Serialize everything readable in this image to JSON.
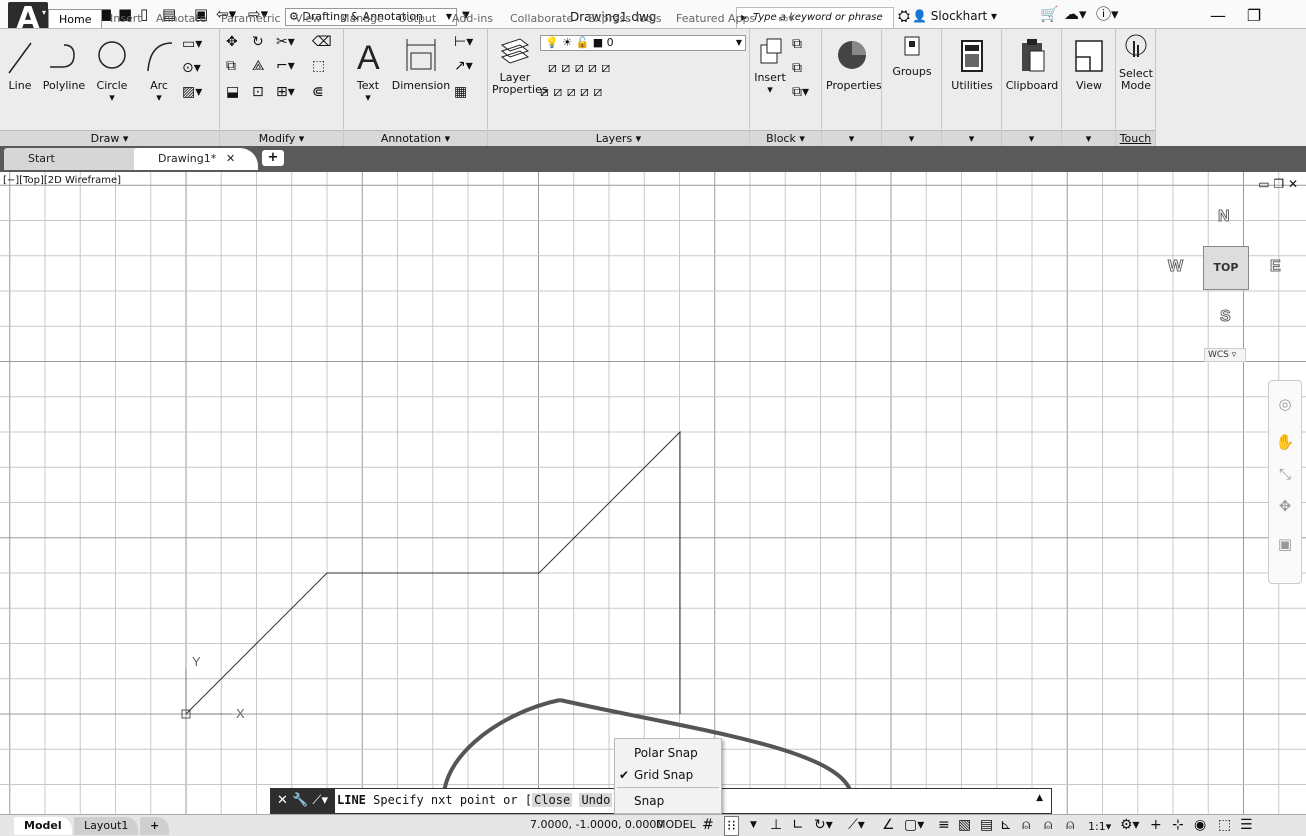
{
  "titlebar": {
    "workspace": "Drafting & Annotation",
    "document_title": "Drawing1.dwg",
    "search_placeholder": "Type a keyword or phrase",
    "user_name": "Slockhart"
  },
  "ribbon_tabs": [
    "Home",
    "Insert",
    "Annotate",
    "Parametric",
    "View",
    "Manage",
    "Output",
    "Add-ins",
    "Collaborate",
    "Express Tools",
    "Featured Apps"
  ],
  "ribbon": {
    "draw": {
      "title": "Draw",
      "line": "Line",
      "polyline": "Polyline",
      "circle": "Circle",
      "arc": "Arc"
    },
    "modify": {
      "title": "Modify"
    },
    "annotation": {
      "title": "Annotation",
      "text": "Text",
      "dimension": "Dimension"
    },
    "layers": {
      "title": "Layers",
      "layer_properties_1": "Layer",
      "layer_properties_2": "Properties",
      "current_layer": "0"
    },
    "block": {
      "title": "Block",
      "insert": "Insert"
    },
    "properties": "Properties",
    "groups": "Groups",
    "utilities": "Utilities",
    "clipboard": "Clipboard",
    "view": "View",
    "select_mode_1": "Select",
    "select_mode_2": "Mode",
    "touch": "Touch"
  },
  "file_tabs": {
    "start": "Start",
    "drawing": "Drawing1*"
  },
  "viewport": {
    "label": "[−][Top][2D Wireframe]"
  },
  "viewcube": {
    "north": "N",
    "south": "S",
    "east": "E",
    "west": "W",
    "face": "TOP",
    "wcs": "WCS"
  },
  "ucs": {
    "x": "X",
    "y": "Y"
  },
  "command_line": {
    "command": "LINE",
    "prompt_a": " Specify n",
    "prompt_b": "xt point or [",
    "opt_close": "Close",
    "opt_undo": "Undo",
    "end": "]:"
  },
  "snap_menu": {
    "polar": "Polar Snap",
    "grid": "Grid Snap",
    "settings": "Snap Settings..."
  },
  "status": {
    "model_tab": "Model",
    "layout_tab": "Layout1",
    "coordinates": "7.0000, -1.0000, 0.0000",
    "model": "MODEL",
    "scale": "1:1"
  }
}
